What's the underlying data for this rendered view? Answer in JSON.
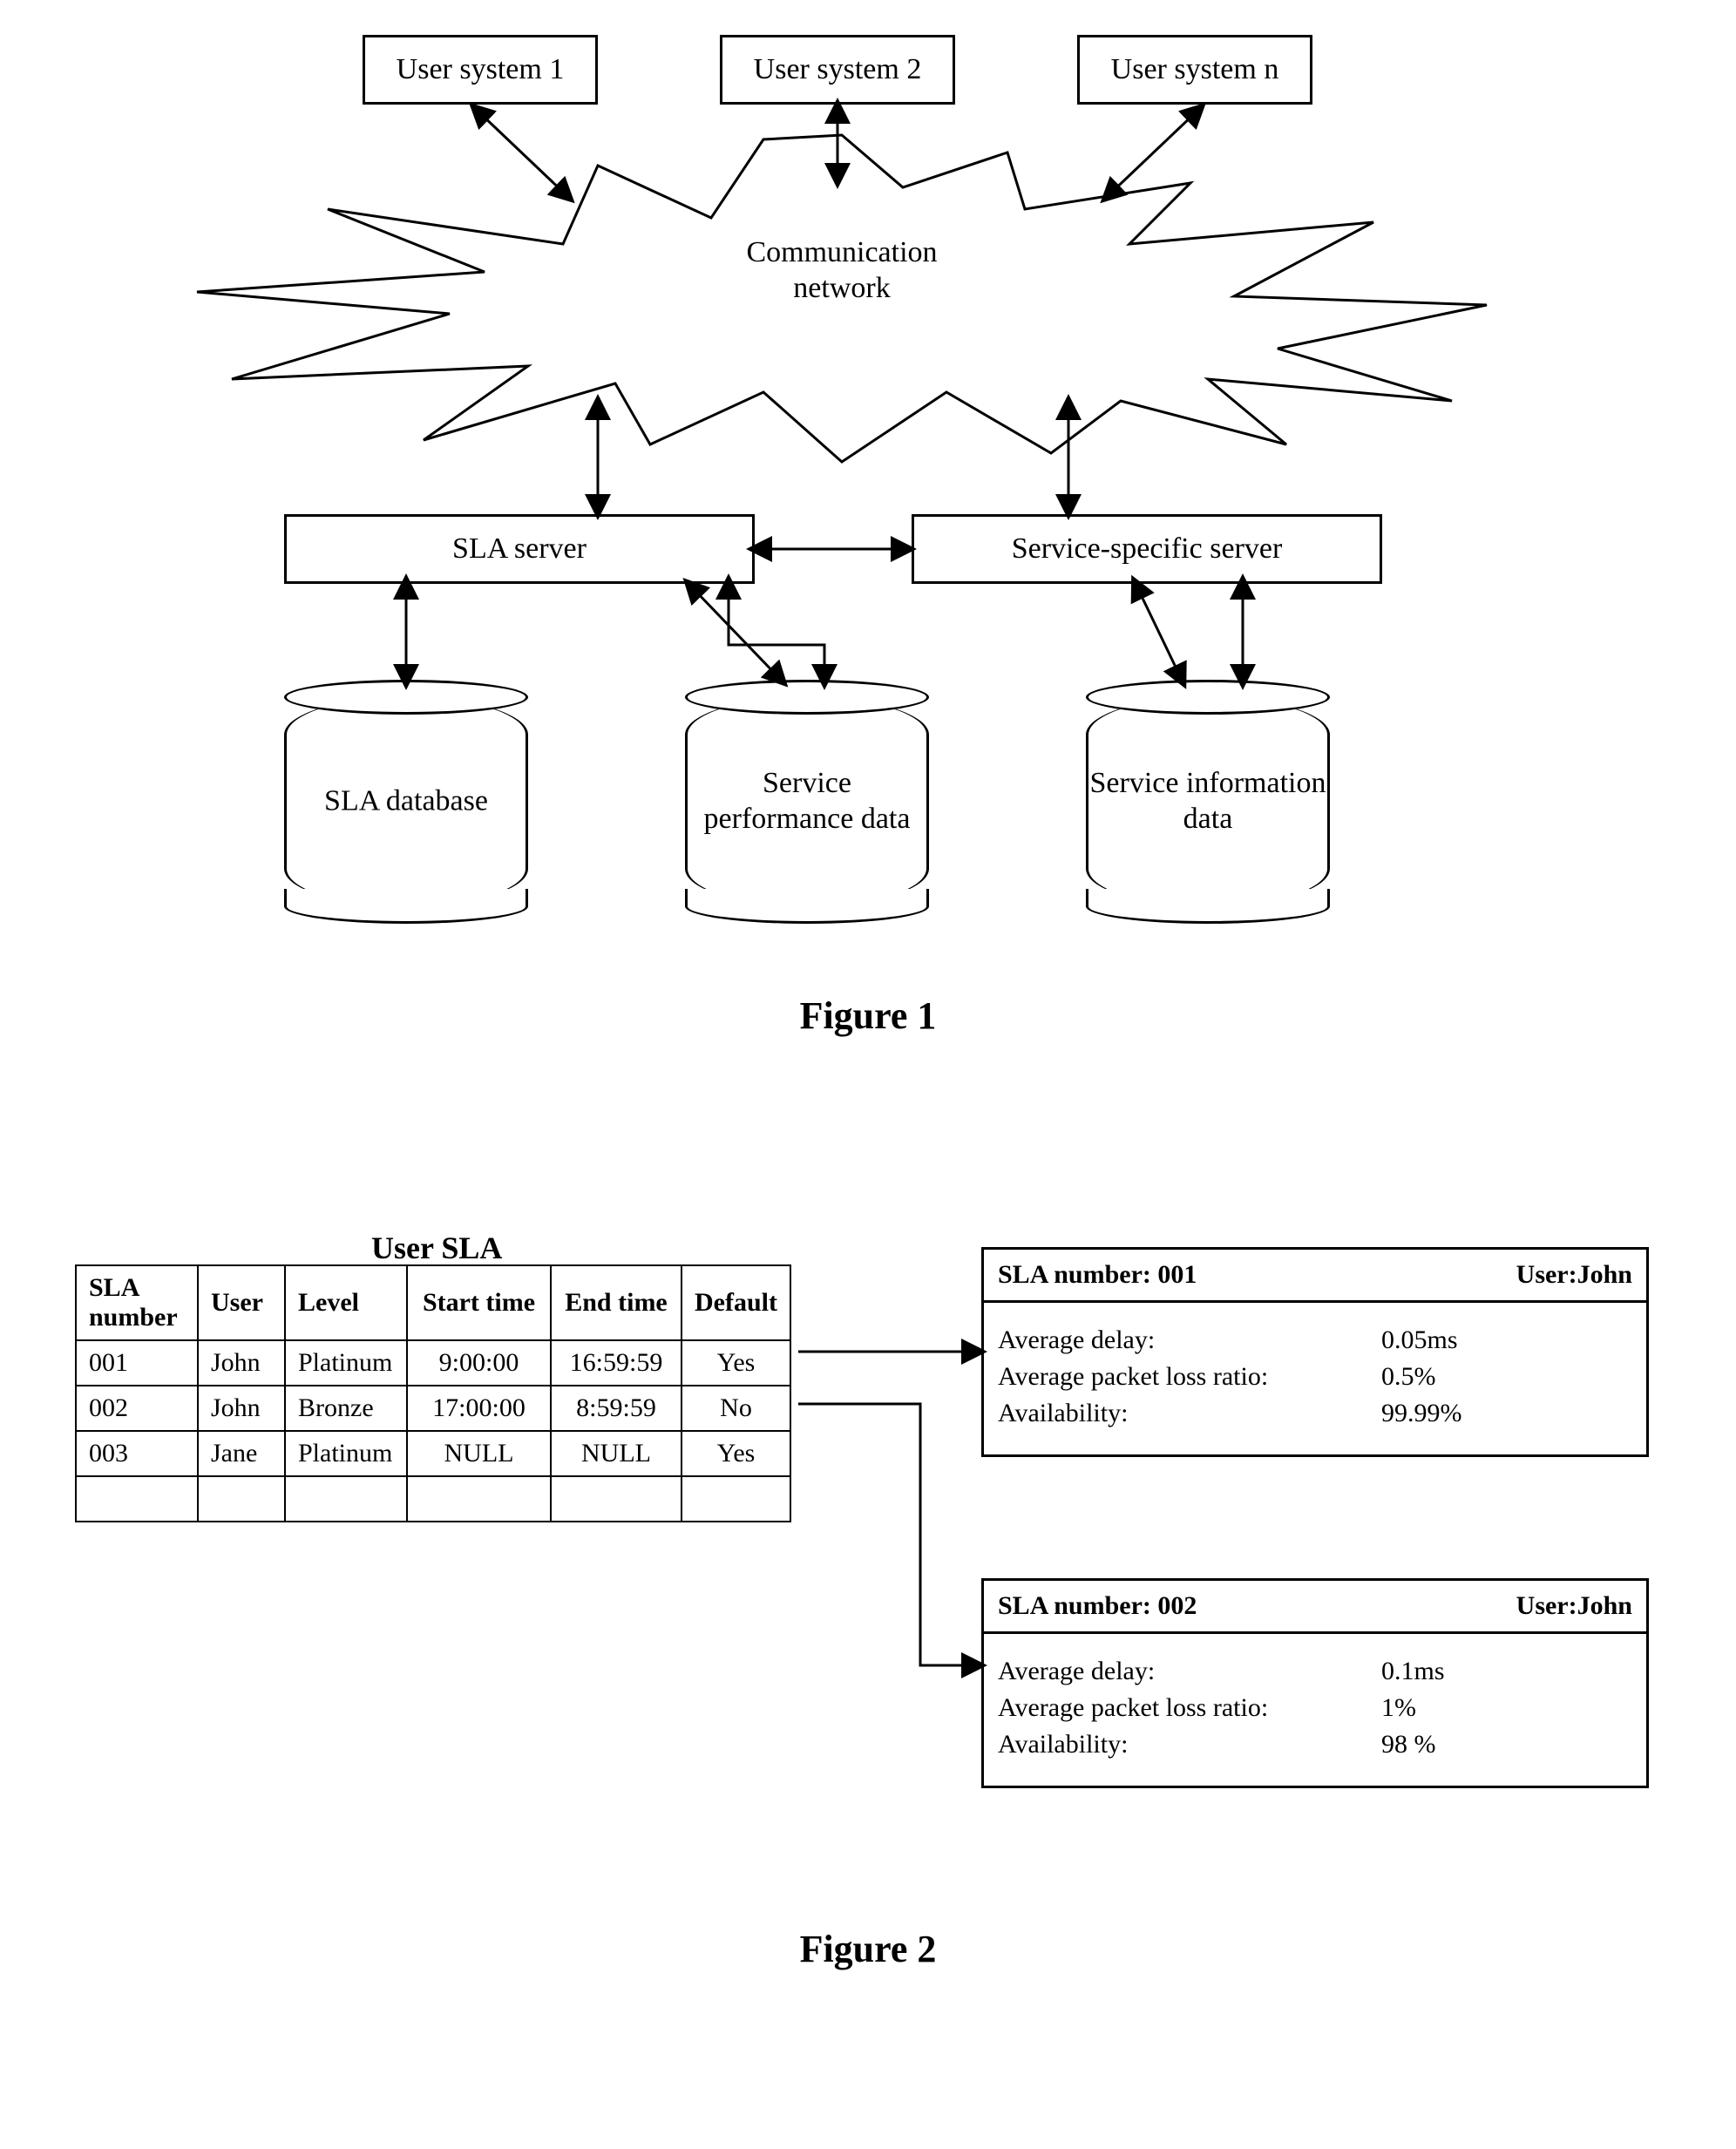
{
  "figure1": {
    "user_systems": [
      "User system 1",
      "User system 2",
      "User system n"
    ],
    "network_label": "Communication network",
    "sla_server": "SLA server",
    "service_server": "Service-specific server",
    "db1": "SLA database",
    "db2": "Service performance data",
    "db3": "Service information data",
    "caption": "Figure 1"
  },
  "figure2": {
    "table_title": "User SLA",
    "headers": [
      "SLA number",
      "User",
      "Level",
      "Start time",
      "End time",
      "Default"
    ],
    "rows": [
      {
        "c0": "001",
        "c1": "John",
        "c2": "Platinum",
        "c3": "9:00:00",
        "c4": "16:59:59",
        "c5": "Yes"
      },
      {
        "c0": "002",
        "c1": "John",
        "c2": "Bronze",
        "c3": "17:00:00",
        "c4": "8:59:59",
        "c5": "No"
      },
      {
        "c0": "003",
        "c1": "Jane",
        "c2": "Platinum",
        "c3": "NULL",
        "c4": "NULL",
        "c5": "Yes"
      }
    ],
    "detail1": {
      "header_left": "SLA number: 001",
      "header_right": "User:John",
      "r1l": "Average delay:",
      "r1v": "0.05ms",
      "r2l": "Average packet loss ratio:",
      "r2v": "0.5%",
      "r3l": "Availability:",
      "r3v": "99.99%"
    },
    "detail2": {
      "header_left": "SLA number: 002",
      "header_right": "User:John",
      "r1l": "Average delay:",
      "r1v": "0.1ms",
      "r2l": "Average packet loss ratio:",
      "r2v": "1%",
      "r3l": "Availability:",
      "r3v": "98 %"
    },
    "caption": "Figure 2"
  }
}
